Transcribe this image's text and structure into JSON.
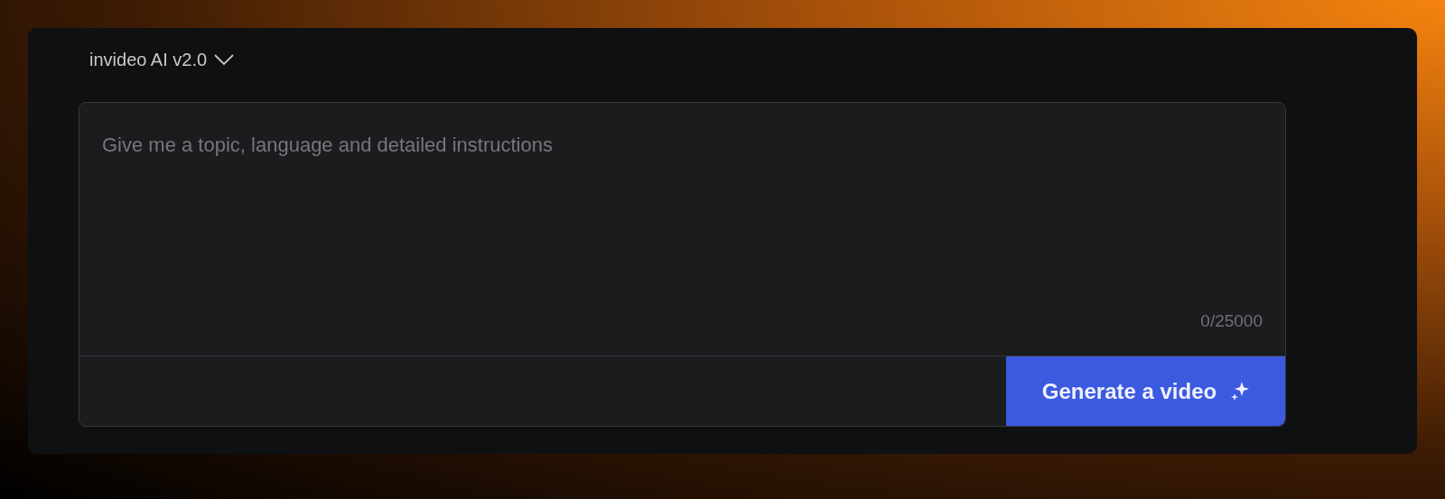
{
  "model_selector": {
    "label": "invideo AI v2.0"
  },
  "prompt": {
    "placeholder": "Give me a topic, language and detailed instructions",
    "counter": "0/25000"
  },
  "generate_button": {
    "label": "Generate a video"
  }
}
